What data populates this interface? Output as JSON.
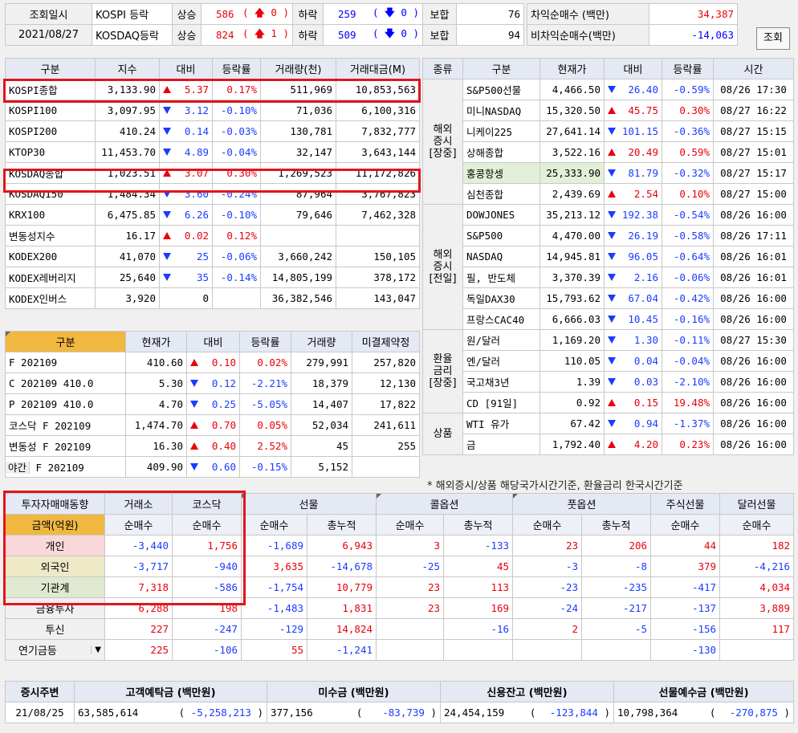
{
  "top": {
    "label1": "조회일시",
    "date": "2021/08/27",
    "kospi_label": "KOSPI 등락",
    "kosdaq_label": "KOSDAQ등락",
    "up_label": "상승",
    "down_label": "하락",
    "flat_label": "보합",
    "kospi_up": "586",
    "kospi_up_limit": "0",
    "kospi_down": "259",
    "kospi_down_limit": "0",
    "kospi_flat": "76",
    "kosdaq_up": "824",
    "kosdaq_up_limit": "1",
    "kosdaq_down": "509",
    "kosdaq_down_limit": "0",
    "kosdaq_flat": "94",
    "arb_label": "차익순매수 (백만)",
    "arb_value": "34,387",
    "nonarb_label": "비차익순매수(백만)",
    "nonarb_value": "-14,063",
    "query_button": "조회"
  },
  "index_table": {
    "headers": [
      "구분",
      "지수",
      "대비",
      "등락률",
      "거래량(천)",
      "거래대금(M)"
    ],
    "rows": [
      {
        "name": "KOSPI종합",
        "value": "3,133.90",
        "dir": "up",
        "change": "5.37",
        "rate": "0.17%",
        "volume": "511,969",
        "amount": "10,853,563"
      },
      {
        "name": "KOSPI100",
        "value": "3,097.95",
        "dir": "dn",
        "change": "3.12",
        "rate": "-0.10%",
        "volume": "71,036",
        "amount": "6,100,316"
      },
      {
        "name": "KOSPI200",
        "value": "410.24",
        "dir": "dn",
        "change": "0.14",
        "rate": "-0.03%",
        "volume": "130,781",
        "amount": "7,832,777"
      },
      {
        "name": "KTOP30",
        "value": "11,453.70",
        "dir": "dn",
        "change": "4.89",
        "rate": "-0.04%",
        "volume": "32,147",
        "amount": "3,643,144"
      },
      {
        "name": "KOSDAQ종합",
        "value": "1,023.51",
        "dir": "up",
        "change": "3.07",
        "rate": "0.30%",
        "volume": "1,269,523",
        "amount": "11,172,826"
      },
      {
        "name": "KOSDAQ150",
        "value": "1,484.34",
        "dir": "dn",
        "change": "3.60",
        "rate": "-0.24%",
        "volume": "87,964",
        "amount": "3,767,823"
      },
      {
        "name": "KRX100",
        "value": "6,475.85",
        "dir": "dn",
        "change": "6.26",
        "rate": "-0.10%",
        "volume": "79,646",
        "amount": "7,462,328"
      },
      {
        "name": "변동성지수",
        "value": "16.17",
        "dir": "up",
        "change": "0.02",
        "rate": "0.12%",
        "volume": "",
        "amount": ""
      },
      {
        "name": "KODEX200",
        "value": "41,070",
        "dir": "dn",
        "change": "25",
        "rate": "-0.06%",
        "volume": "3,660,242",
        "amount": "150,105"
      },
      {
        "name": "KODEX레버리지",
        "value": "25,640",
        "dir": "dn",
        "change": "35",
        "rate": "-0.14%",
        "volume": "14,805,199",
        "amount": "378,172"
      },
      {
        "name": "KODEX인버스",
        "value": "3,920",
        "dir": "",
        "change": "0",
        "rate": "",
        "volume": "36,382,546",
        "amount": "143,047"
      }
    ]
  },
  "futures_table": {
    "headers": [
      "구분",
      "현재가",
      "대비",
      "등락률",
      "거래량",
      "미결제약정"
    ],
    "rows": [
      {
        "name": "F 202109",
        "price": "410.60",
        "dir": "up",
        "change": "0.10",
        "rate": "0.02%",
        "volume": "279,991",
        "oi": "257,820"
      },
      {
        "name": "C 202109 410.0",
        "price": "5.30",
        "dir": "dn",
        "change": "0.12",
        "rate": "-2.21%",
        "volume": "18,379",
        "oi": "12,130"
      },
      {
        "name": "P 202109 410.0",
        "price": "4.70",
        "dir": "dn",
        "change": "0.25",
        "rate": "-5.05%",
        "volume": "14,407",
        "oi": "17,822"
      },
      {
        "name": "코스닥 F 202109",
        "price": "1,474.70",
        "dir": "up",
        "change": "0.70",
        "rate": "0.05%",
        "volume": "52,034",
        "oi": "241,611"
      },
      {
        "name": "변동성 F 202109",
        "price": "16.30",
        "dir": "up",
        "change": "0.40",
        "rate": "2.52%",
        "volume": "45",
        "oi": "255"
      },
      {
        "name_prefix": "야간",
        "name": "F 202109",
        "price": "409.90",
        "dir": "dn",
        "change": "0.60",
        "rate": "-0.15%",
        "volume": "5,152",
        "oi": ""
      }
    ]
  },
  "world_table": {
    "headers": [
      "종류",
      "구분",
      "현재가",
      "대비",
      "등락률",
      "시간"
    ],
    "groups": [
      {
        "label": "해외\n증시\n[장중]",
        "rows": [
          {
            "name": "S&P500선물",
            "price": "4,466.50",
            "dir": "dn",
            "change": "26.40",
            "rate": "-0.59%",
            "time": "08/26 17:30"
          },
          {
            "name": "미니NASDAQ",
            "price": "15,320.50",
            "dir": "up",
            "change": "45.75",
            "rate": "0.30%",
            "time": "08/27 16:22"
          },
          {
            "name": "니케이225",
            "price": "27,641.14",
            "dir": "dn",
            "change": "101.15",
            "rate": "-0.36%",
            "time": "08/27 15:15"
          },
          {
            "name": "상해종합",
            "price": "3,522.16",
            "dir": "up",
            "change": "20.49",
            "rate": "0.59%",
            "time": "08/27 15:01"
          },
          {
            "name": "홍콩항셍",
            "price": "25,333.90",
            "dir": "dn",
            "change": "81.79",
            "rate": "-0.32%",
            "time": "08/27 15:17"
          },
          {
            "name": "심천종합",
            "price": "2,439.69",
            "dir": "up",
            "change": "2.54",
            "rate": "0.10%",
            "time": "08/27 15:00"
          }
        ]
      },
      {
        "label": "해외\n증시\n[전일]",
        "rows": [
          {
            "name": "DOWJONES",
            "price": "35,213.12",
            "dir": "dn",
            "change": "192.38",
            "rate": "-0.54%",
            "time": "08/26 16:00"
          },
          {
            "name": "S&P500",
            "price": "4,470.00",
            "dir": "dn",
            "change": "26.19",
            "rate": "-0.58%",
            "time": "08/26 17:11"
          },
          {
            "name": "NASDAQ",
            "price": "14,945.81",
            "dir": "dn",
            "change": "96.05",
            "rate": "-0.64%",
            "time": "08/26 16:01"
          },
          {
            "name": "필, 반도체",
            "price": "3,370.39",
            "dir": "dn",
            "change": "2.16",
            "rate": "-0.06%",
            "time": "08/26 16:01"
          },
          {
            "name": "독일DAX30",
            "price": "15,793.62",
            "dir": "dn",
            "change": "67.04",
            "rate": "-0.42%",
            "time": "08/26 16:00"
          },
          {
            "name": "프랑스CAC40",
            "price": "6,666.03",
            "dir": "dn",
            "change": "10.45",
            "rate": "-0.16%",
            "time": "08/26 16:00"
          }
        ]
      },
      {
        "label": "환율\n금리\n[장중]",
        "rows": [
          {
            "name": "원/달러",
            "price": "1,169.20",
            "dir": "dn",
            "change": "1.30",
            "rate": "-0.11%",
            "time": "08/27 15:30"
          },
          {
            "name": "엔/달러",
            "price": "110.05",
            "dir": "dn",
            "change": "0.04",
            "rate": "-0.04%",
            "time": "08/26 16:00"
          },
          {
            "name": "국고채3년",
            "price": "1.39",
            "dir": "dn",
            "change": "0.03",
            "rate": "-2.10%",
            "time": "08/26 16:00"
          },
          {
            "name": "CD [91일]",
            "price": "0.92",
            "dir": "up",
            "change": "0.15",
            "rate": "19.48%",
            "time": "08/26 16:00"
          }
        ]
      },
      {
        "label": "상품",
        "rows": [
          {
            "name": "WTI 유가",
            "price": "67.42",
            "dir": "dn",
            "change": "0.94",
            "rate": "-1.37%",
            "time": "08/26 16:00"
          },
          {
            "name": "금",
            "price": "1,792.40",
            "dir": "up",
            "change": "4.20",
            "rate": "0.23%",
            "time": "08/26 16:00"
          }
        ]
      }
    ],
    "note": "* 해외증시/상품 해당국가시간기준, 환율금리 한국시간기준"
  },
  "investor_table": {
    "title": "투자자매매동향",
    "unit": "금액(억원)",
    "col_groups": [
      "거래소",
      "코스닥",
      "선물",
      "콜옵션",
      "풋옵션",
      "주식선물",
      "달러선물"
    ],
    "net_buy": "순매수",
    "cumulative": "총누적",
    "rows": [
      {
        "name": "개인",
        "vals": [
          "-3,440",
          "1,756",
          "-1,689",
          "6,943",
          "3",
          "-133",
          "23",
          "206",
          "44",
          "182"
        ]
      },
      {
        "name": "외국인",
        "vals": [
          "-3,717",
          "-940",
          "3,635",
          "-14,678",
          "-25",
          "45",
          "-3",
          "-8",
          "379",
          "-4,216"
        ]
      },
      {
        "name": "기관계",
        "vals": [
          "7,318",
          "-586",
          "-1,754",
          "10,779",
          "23",
          "113",
          "-23",
          "-235",
          "-417",
          "4,034"
        ]
      },
      {
        "name": "금융투자",
        "vals": [
          "6,288",
          "198",
          "-1,483",
          "1,831",
          "23",
          "169",
          "-24",
          "-217",
          "-137",
          "3,889"
        ]
      },
      {
        "name": "투신",
        "vals": [
          "227",
          "-247",
          "-129",
          "14,824",
          "",
          "-16",
          "2",
          "-5",
          "-156",
          "117"
        ]
      },
      {
        "name": "연기금등",
        "vals": [
          "225",
          "-106",
          "55",
          "-1,241",
          "",
          "",
          "",
          "",
          "-130",
          ""
        ]
      }
    ]
  },
  "bottom": {
    "headers": [
      "증시주변",
      "고객예탁금 (백만원)",
      "미수금 (백만원)",
      "신용잔고 (백만원)",
      "선물예수금 (백만원)"
    ],
    "date": "21/08/25",
    "deposit": "63,585,614",
    "deposit_chg": "-5,258,213",
    "unpaid": "377,156",
    "unpaid_chg": "-83,739",
    "credit": "24,454,159",
    "credit_chg": "-123,844",
    "fut_deposit": "10,798,364",
    "fut_deposit_chg": "-270,875"
  },
  "colors": {
    "up": "#e8000b",
    "down": "#1a3cff",
    "highlight": "#e0151e",
    "header": "#e4e9f4",
    "orange": "#f0b840"
  }
}
